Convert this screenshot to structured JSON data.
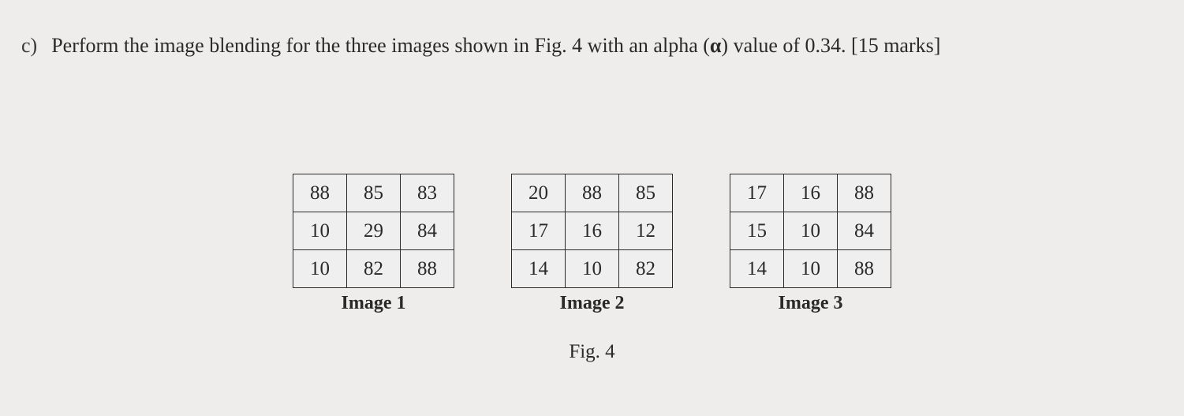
{
  "question": {
    "marker": "c)",
    "text_before_alpha": "Perform the image blending for the three images shown in Fig. 4 with an alpha (",
    "alpha_symbol": "α",
    "text_after_alpha": ") value of 0.34. [15 marks]"
  },
  "images": [
    {
      "label": "Image 1",
      "rows": [
        [
          "88",
          "85",
          "83"
        ],
        [
          "10",
          "29",
          "84"
        ],
        [
          "10",
          "82",
          "88"
        ]
      ]
    },
    {
      "label": "Image 2",
      "rows": [
        [
          "20",
          "88",
          "85"
        ],
        [
          "17",
          "16",
          "12"
        ],
        [
          "14",
          "10",
          "82"
        ]
      ]
    },
    {
      "label": "Image 3",
      "rows": [
        [
          "17",
          "16",
          "88"
        ],
        [
          "15",
          "10",
          "84"
        ],
        [
          "14",
          "10",
          "88"
        ]
      ]
    }
  ],
  "figure_caption": "Fig. 4"
}
